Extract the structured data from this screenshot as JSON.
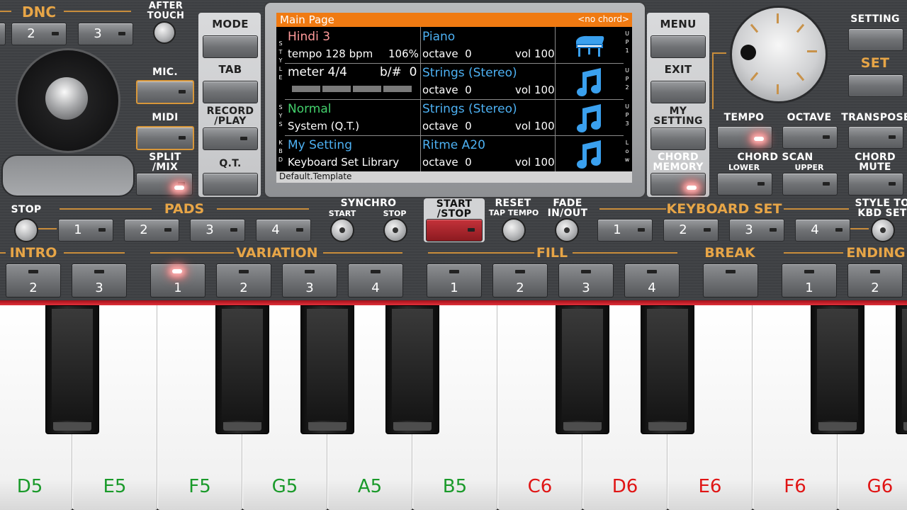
{
  "top_left": {
    "dnc_label": "DNC",
    "dnc_buttons": [
      "2",
      "3"
    ],
    "after_touch_label": "AFTER\nTOUCH",
    "mic_label": "MIC.",
    "midi_label": "MIDI",
    "split_mix_label": "SPLIT\n/MIX"
  },
  "left_column": {
    "mode_label": "MODE",
    "tab_label": "TAB",
    "record_play_label": "RECORD\n/PLAY",
    "qt_label": "Q.T."
  },
  "right_column": {
    "menu_label": "MENU",
    "exit_label": "EXIT",
    "my_setting_label": "MY\nSETTING",
    "chord_memory_label": "CHORD\nMEMORY"
  },
  "top_right": {
    "setting_label": "SETTING",
    "set_label": "SET",
    "tempo_label": "TEMPO",
    "octave_label": "OCTAVE",
    "transpose_label": "TRANSPOSE",
    "chord_scan_label": "CHORD SCAN",
    "lower_label": "LOWER",
    "upper_label": "UPPER",
    "chord_mute_label": "CHORD\nMUTE"
  },
  "display": {
    "header_title": "Main Page",
    "header_chord": "<no chord>",
    "style_name": "Hindi 3",
    "tempo_text": "tempo 128 bpm",
    "tempo_percent": "106%",
    "meter_text": "meter 4/4",
    "key_text": "b/#  0",
    "sys_name": "Normal",
    "sys_sub": "System (Q.T.)",
    "kbd_name": "My Setting",
    "kbd_sub": "Keyboard Set Library",
    "footer": "Default.Template",
    "left_labels": {
      "style": "STYLE",
      "sys": "SYS",
      "kbd": "KBD"
    },
    "right_labels": {
      "up1": "UP1",
      "up2": "UP2",
      "up3": "UP3",
      "low": "Low"
    },
    "tracks": [
      {
        "name": "Piano",
        "octave": "octave  0",
        "vol": "vol 100",
        "icon": "grand-piano-icon"
      },
      {
        "name": "Strings (Stereo)",
        "octave": "octave  0",
        "vol": "vol 100",
        "icon": "music-note-icon"
      },
      {
        "name": "Strings (Stereo)",
        "octave": "octave  0",
        "vol": "vol 100",
        "icon": "music-note-icon"
      },
      {
        "name": "Ritme A20",
        "octave": "octave  0",
        "vol": "vol 100",
        "icon": "music-note-icon"
      }
    ],
    "colors": {
      "header": "#f07a12",
      "blue_text": "#4db1f3",
      "green_text": "#43d06c",
      "pink_text": "#ff9a9a"
    }
  },
  "row_controls": {
    "stop_label": "STOP",
    "pads_label": "PADS",
    "pads": [
      "1",
      "2",
      "3",
      "4"
    ],
    "synchro_label": "SYNCHRO",
    "synchro_start_label": "START",
    "synchro_stop_label": "STOP",
    "start_stop_label": "START\n/STOP",
    "reset_label": "RESET",
    "tap_tempo_label": "TAP TEMPO",
    "fade_label": "FADE\nIN/OUT",
    "keyboard_set_label": "KEYBOARD SET",
    "keyboard_set": [
      "1",
      "2",
      "3",
      "4"
    ],
    "style_to_kbd_label": "STYLE TO\nKBD SET"
  },
  "sections": {
    "intro_label": "INTRO",
    "intro": [
      "2",
      "3"
    ],
    "variation_label": "VARIATION",
    "variation": [
      "1",
      "2",
      "3",
      "4"
    ],
    "fill_label": "FILL",
    "fill": [
      "1",
      "2",
      "3",
      "4"
    ],
    "break_label": "BREAK",
    "ending_label": "ENDING",
    "ending": [
      "1",
      "2"
    ]
  },
  "keyboard": {
    "white_keys": [
      "D5",
      "E5",
      "F5",
      "G5",
      "A5",
      "B5",
      "C6",
      "D6",
      "E6",
      "F6",
      "G6"
    ],
    "green_color": "#1a9a2a",
    "red_color": "#e01515"
  }
}
